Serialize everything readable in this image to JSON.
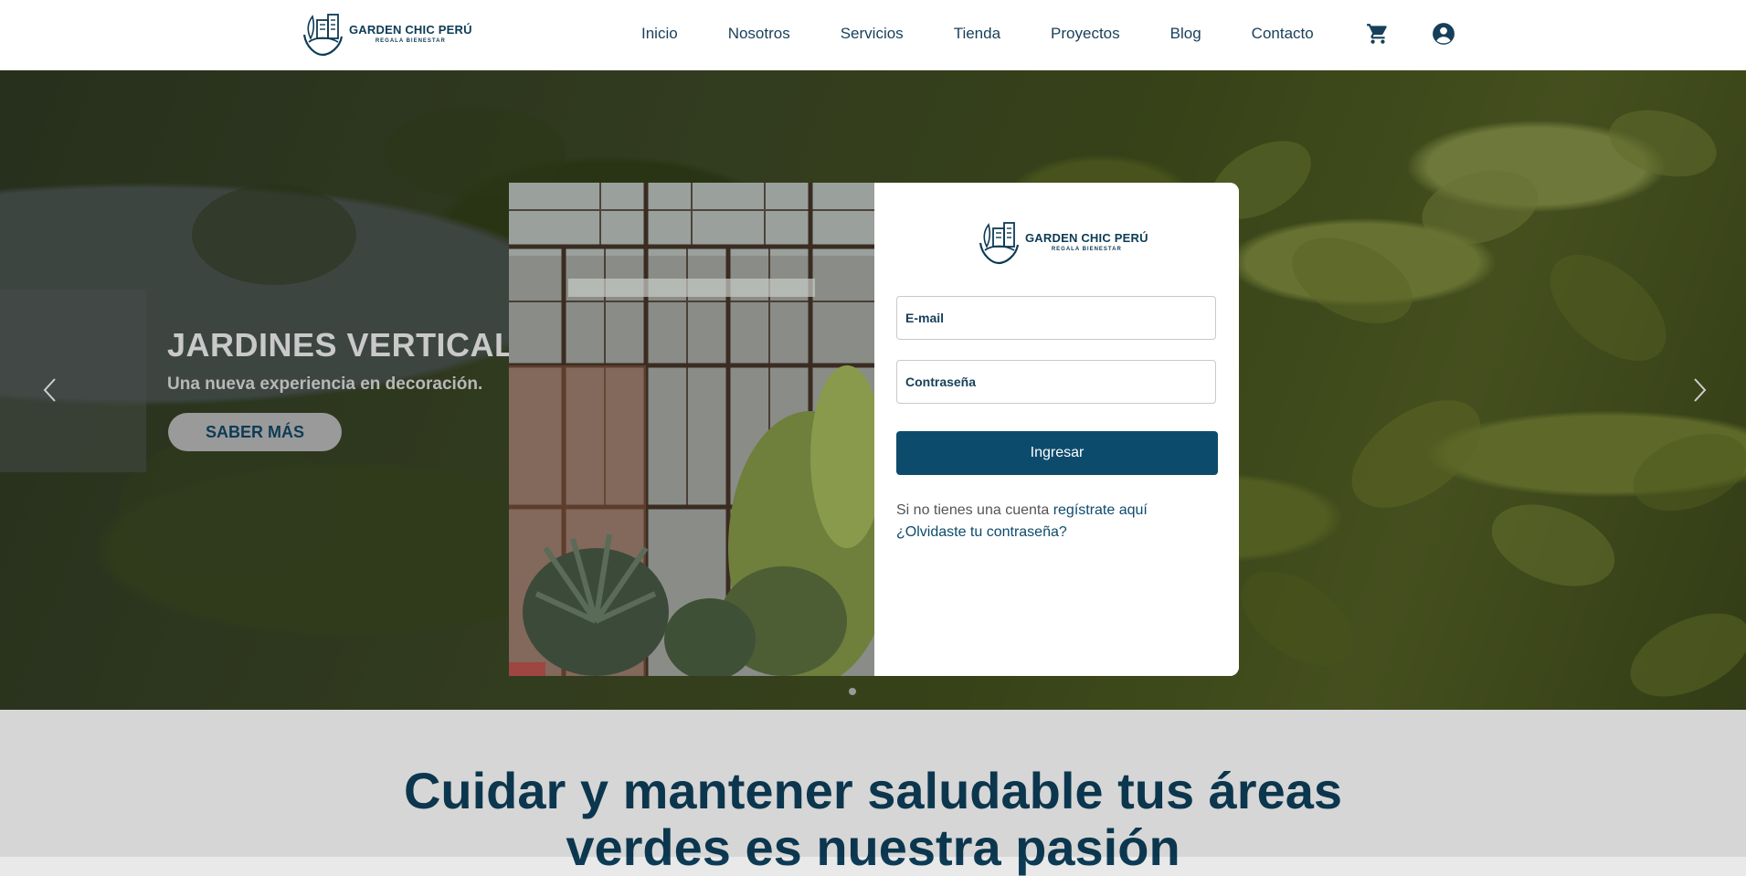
{
  "brand": {
    "name": "GARDEN CHIC PERÚ",
    "tagline": "REGALA BIENESTAR"
  },
  "nav": {
    "items": [
      "Inicio",
      "Nosotros",
      "Servicios",
      "Tienda",
      "Proyectos",
      "Blog",
      "Contacto"
    ],
    "cart_icon": "cart-icon",
    "user_icon": "user-account-icon"
  },
  "hero": {
    "title": "JARDINES VERTICALES",
    "subtitle": "Una nueva experiencia en decoración.",
    "button": "SABER MÁS",
    "prev_icon": "chevron-left-icon",
    "next_icon": "chevron-right-icon"
  },
  "login": {
    "email_placeholder": "E-mail",
    "password_placeholder": "Contraseña",
    "submit": "Ingresar",
    "no_account_text": "Si no tienes una cuenta",
    "register_link": "regístrate aquí",
    "forgot_link": "¿Olvidaste tu contraseña?"
  },
  "section": {
    "title_line1": "Cuidar y mantener saludable tus áreas",
    "title_line2": "verdes es nuestra pasión"
  },
  "colors": {
    "brand_navy": "#0d3b55",
    "button_blue": "#0d4b6c"
  }
}
